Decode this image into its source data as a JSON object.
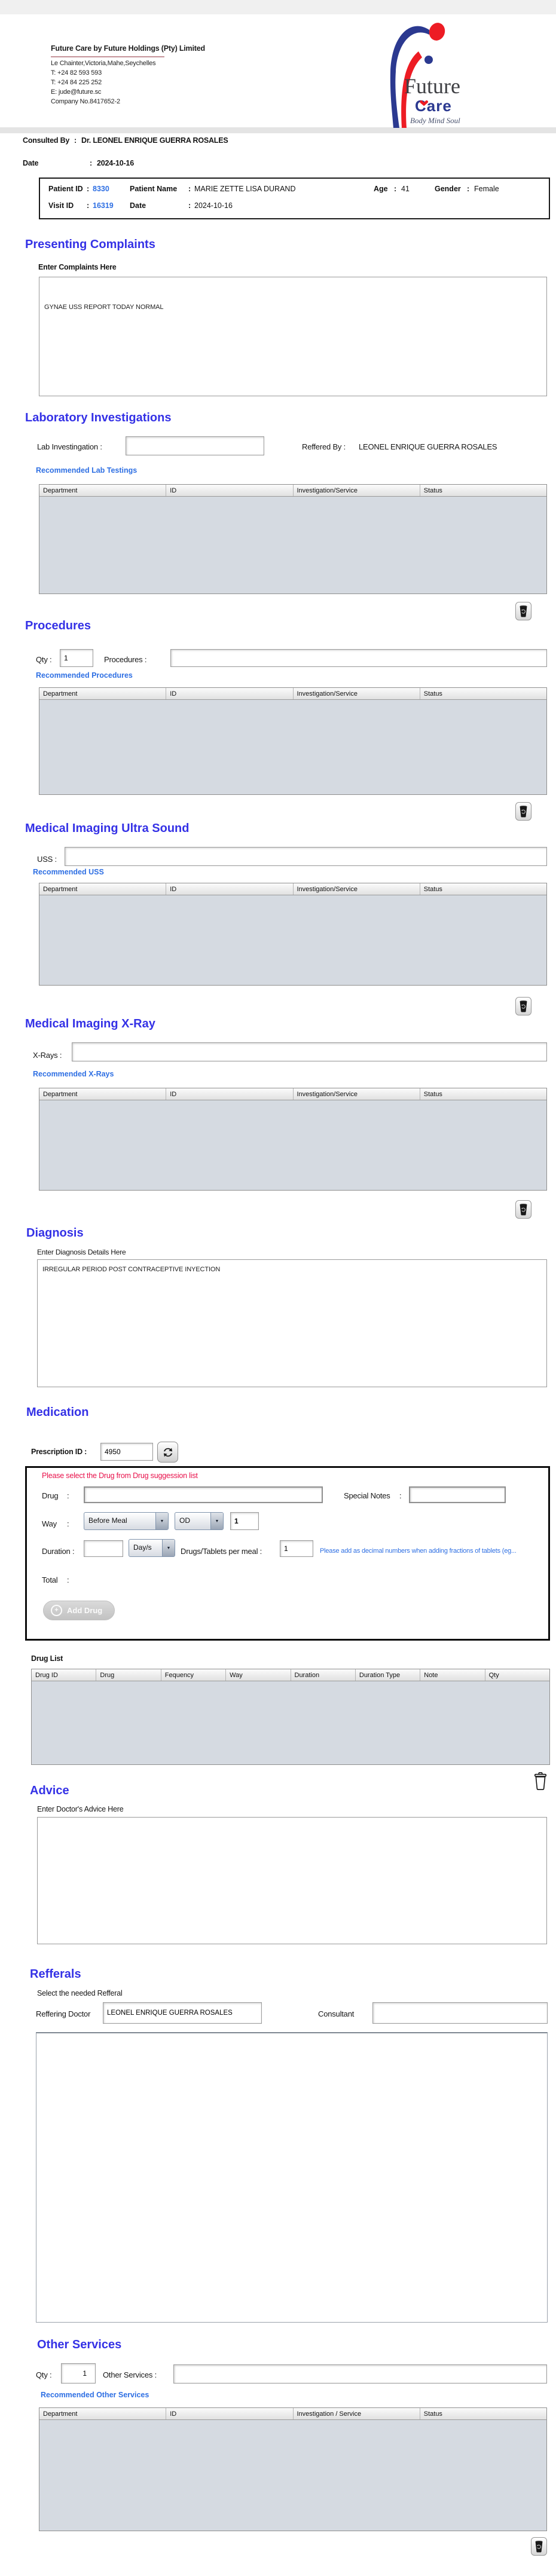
{
  "ui": {
    "colon": ":",
    "dropdown_arrow": "▼",
    "plus": "+"
  },
  "header": {
    "company": {
      "title": "Future Care by Future Holdings (Pty) Limited",
      "address": "Le Chainter,Victoria,Mahe,Seychelles",
      "phone1": "T: +24  82 593 593",
      "phone2": "T: +24  84 225 252",
      "email": "E: jude@future.sc",
      "company_no": "Company No.8417652-2"
    },
    "logo": {
      "name": "Future",
      "sub": "Care",
      "tagline": "Body Mind Soul",
      "blue": "#2b3990",
      "red": "#ed1c24"
    },
    "consulted_label": "Consulted By",
    "consulted_value": "Dr.  LEONEL ENRIQUE GUERRA ROSALES",
    "date_label": "Date",
    "date_value": "2024-10-16"
  },
  "patient": {
    "patient_id_label": "Patient ID",
    "patient_id": "8330",
    "patient_name_label": "Patient Name",
    "patient_name": "MARIE ZETTE LISA DURAND",
    "age_label": "Age",
    "age": "41",
    "gender_label": "Gender",
    "gender": "Female",
    "visit_id_label": "Visit ID",
    "visit_id": "16319",
    "date_label": "Date",
    "date": "2024-10-16"
  },
  "complaints": {
    "heading": "Presenting Complaints",
    "label": "Enter Complaints Here",
    "value": "GYNAE USS REPORT TODAY NORMAL"
  },
  "lab": {
    "heading": "Laboratory  Investigations",
    "label": "Lab Investingation :",
    "field_value": "",
    "referred_label": "Reffered By :",
    "referred_value": "LEONEL ENRIQUE GUERRA ROSALES",
    "link": "Recommended Lab Testings",
    "headers": [
      "Department",
      "ID",
      "Investigation/Service",
      "Status"
    ]
  },
  "procedures": {
    "heading": "Procedures",
    "qty_label": "Qty :",
    "qty_value": "1",
    "label": "Procedures :",
    "field_value": "",
    "link": "Recommended Procedures",
    "headers": [
      "Department",
      "ID",
      "Investigation/Service",
      "Status"
    ]
  },
  "uss": {
    "heading": "Medical Imaging Ultra Sound",
    "label": "USS :",
    "field_value": "",
    "link": "Recommended USS",
    "headers": [
      "Department",
      "ID",
      "Investigation/Service",
      "Status"
    ]
  },
  "xray": {
    "heading": "Medical Imaging X-Ray",
    "label": "X-Rays :",
    "field_value": "",
    "link": "Recommended X-Rays",
    "headers": [
      "Department",
      "ID",
      "Investigation/Service",
      "Status"
    ]
  },
  "diagnosis": {
    "heading": "Diagnosis",
    "label": "Enter Diagnosis Details Here",
    "value": "IRREGULAR PERIOD POST CONTRACEPTIVE INYECTION"
  },
  "medication": {
    "heading": "Medication",
    "prescription_label": "Prescription ID :",
    "prescription_value": "4950",
    "drug_note": "Please select the Drug from Drug suggession list",
    "drug_label": "Drug",
    "drug_value": "",
    "special_notes_label": "Special Notes",
    "special_notes_value": "",
    "way_label": "Way",
    "way_value": "Before Meal",
    "frequency_value": "OD",
    "way_qty": "1",
    "duration_label": "Duration :",
    "duration_value": "",
    "duration_type": "Day/s",
    "per_meal_label": "Drugs/Tablets per meal :",
    "per_meal_value": "1",
    "fraction_note": "Please add as decimal numbers when adding fractions of tablets (eg...",
    "total_label": "Total",
    "add_drug_label": "Add Drug",
    "drug_list_label": "Drug List",
    "drug_headers": [
      "Drug ID",
      "Drug",
      "Fequency",
      "Way",
      "Duration",
      "Duration Type",
      "Note",
      "Qty"
    ]
  },
  "advice": {
    "heading": "Advice",
    "label": "Enter Doctor's Advice Here",
    "value": ""
  },
  "refferals": {
    "heading": "Refferals",
    "sub": "Select the needed Refferal",
    "doctor_label": "Reffering Doctor",
    "doctor_value": "LEONEL ENRIQUE GUERRA ROSALES",
    "consultant_label": "Consultant",
    "consultant_value": ""
  },
  "other": {
    "heading": "Other Services",
    "qty_label": "Qty :",
    "qty_value": "1",
    "label": "Other Services :",
    "field_value": "",
    "link": "Recommended Other Services",
    "headers": [
      "Department",
      "ID",
      "Investigation / Service",
      "Status"
    ]
  }
}
